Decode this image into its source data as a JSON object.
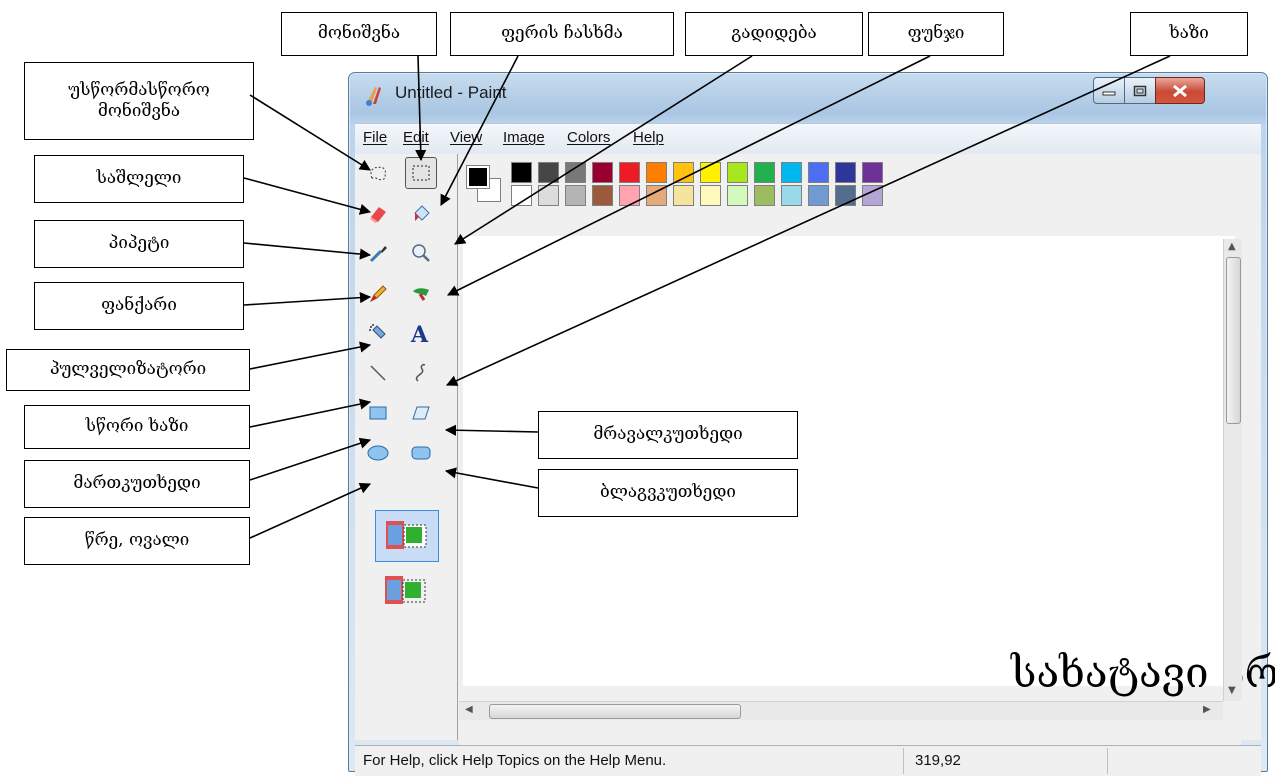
{
  "window": {
    "title": "Untitled - Paint",
    "menu": [
      "File",
      "Edit",
      "View",
      "Image",
      "Colors",
      "Help"
    ]
  },
  "status": {
    "help_text": "For Help, click Help Topics on the Help Menu.",
    "coords": "319,92"
  },
  "canvas": {
    "label": "სახატავი არე"
  },
  "callouts": {
    "select": "მონიშვნა",
    "fill": "ფერის ჩასხმა",
    "magnifier": "გადიდება",
    "brush": "ფუნჯი",
    "curve": "ხაზი",
    "free_select": "უსწორმასწორო მონიშვნა",
    "eraser": "საშლელი",
    "picker": "პიპეტი",
    "pencil": "ფანქარი",
    "airbrush": "პულველიზატორი",
    "line": "სწორი ხაზი",
    "rectangle": "მართკუთხედი",
    "ellipse": "წრე, ოვალი",
    "polygon": "მრავალკუთხედი",
    "rounded_rect": "ბლაგვკუთხედი"
  },
  "palette": {
    "foreground": "#000000",
    "background": "#ffffff",
    "row1": [
      "#000000",
      "#464646",
      "#787878",
      "#990030",
      "#ed1c24",
      "#ff7e00",
      "#ffc20e",
      "#fff200",
      "#a8e61d",
      "#22b14c",
      "#00b7ef",
      "#4d6df3",
      "#2f3699",
      "#6f3198"
    ],
    "row2": [
      "#ffffff",
      "#dcdcdc",
      "#b4b4b4",
      "#9c5a3c",
      "#ffa3b1",
      "#e5aa7a",
      "#f5e49c",
      "#fff9bd",
      "#d3f9bc",
      "#9dbb61",
      "#99d9ea",
      "#709ad1",
      "#546d8e",
      "#b5a5d5"
    ]
  },
  "colors": {
    "window_frame": "#a9c6e3",
    "close_button": "#c84a36"
  }
}
